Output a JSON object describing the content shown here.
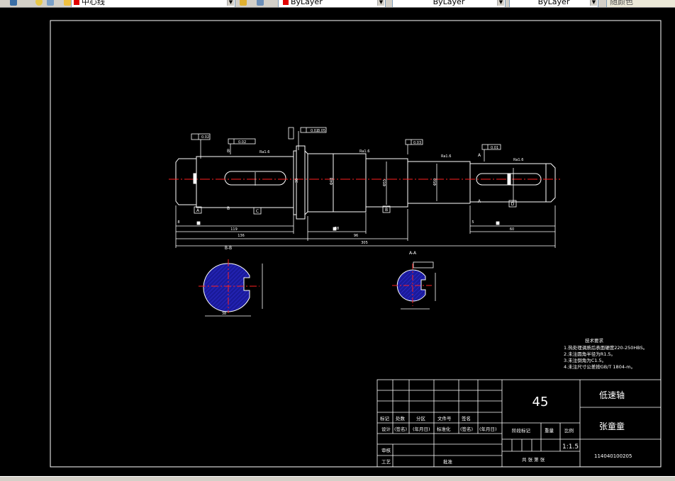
{
  "toolbar": {
    "layer_name": "中心线",
    "color_value": "ByLayer",
    "linetype_value": "ByLayer",
    "lineweight_value": "ByLayer",
    "plotstyle_value": "随颜色"
  },
  "drawing": {
    "tech_title": "技术要求",
    "tech_notes": [
      "1.热处理调质后表面硬度220-250HBS。",
      "2.未注圆角半径为R1.5。",
      "3.未注倒角为C1.5。",
      "4.未注尺寸公差按GB/T 1804-m。"
    ],
    "section_bb": "B-B",
    "section_aa": "A-A",
    "datums": {
      "a": "A",
      "b": "B",
      "c": "C",
      "d": "D"
    },
    "dims": {
      "d119": "119",
      "d136": "136",
      "d58": "58",
      "d96": "96",
      "d60": "60",
      "d8": "8",
      "d5": "5",
      "d305": "305",
      "d38": "38",
      "dphi": "Φ48",
      "dphi2": "Φ55",
      "dphi3": "Φ50"
    },
    "gdt": {
      "g1": "0.02",
      "g2": "0.02",
      "g3": "0.03",
      "g4": "0.01",
      "g5": "0.05",
      "g6": "0.02",
      "ra": "Ra1.6"
    }
  },
  "title_block": {
    "material": "45",
    "part_name": "低速轴",
    "designer_name": "张童童",
    "scale": "1:1.5",
    "drawing_no": "114040100205",
    "hdr_mark": "标记",
    "hdr_count": "处数",
    "hdr_zone": "分区",
    "hdr_docno": "文件号",
    "hdr_sign": "签名",
    "hdr_date": "年月日",
    "row_design": "设计",
    "sign_paren": "(签名)",
    "date_paren": "(年月日)",
    "std": "标准化",
    "sign_paren2": "(签名)",
    "date_paren2": "(年月日)",
    "stage": "阶段标记",
    "weight": "重量",
    "ratio": "比例",
    "review": "审核",
    "craft": "工艺",
    "approve": "批准",
    "sheets": "共  张  第  张"
  }
}
